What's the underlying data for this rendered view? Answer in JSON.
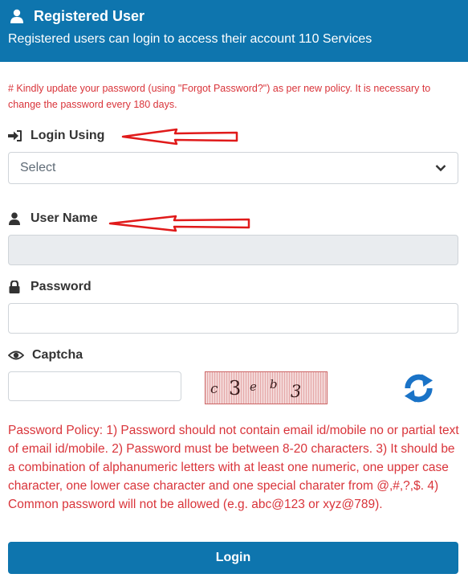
{
  "header": {
    "title": "Registered User",
    "subtitle": "Registered users can login to access their account 110 Services"
  },
  "notice": "# Kindly update your password (using \"Forgot Password?\") as per new policy. It is necessary to change the password every 180 days.",
  "login_using": {
    "label": "Login Using",
    "selected": "Select"
  },
  "user_name": {
    "label": "User Name",
    "value": ""
  },
  "password": {
    "label": "Password",
    "value": ""
  },
  "captcha": {
    "label": "Captcha",
    "value": "",
    "image_text": [
      "c",
      "3",
      "e",
      "b",
      "3"
    ]
  },
  "policy": "Password Policy: 1) Password should not contain email id/mobile no or partial text of email id/mobile. 2) Password must be between 8-20 characters. 3) It should be a combination of alphanumeric letters with at least one numeric, one upper case character, one lower case character and one special charater from @,#,?,$. 4) Common password will not be allowed (e.g. abc@123 or xyz@789).",
  "login_button": "Login",
  "colors": {
    "brand_blue": "#0e75ae",
    "alert_red": "#d9343a",
    "arrow_red": "#e01a1a"
  },
  "icons": {
    "header": "user-icon",
    "login_using": "sign-in-icon",
    "user_name": "user-icon",
    "password": "lock-icon",
    "captcha": "eye-icon",
    "refresh": "refresh-icon"
  }
}
